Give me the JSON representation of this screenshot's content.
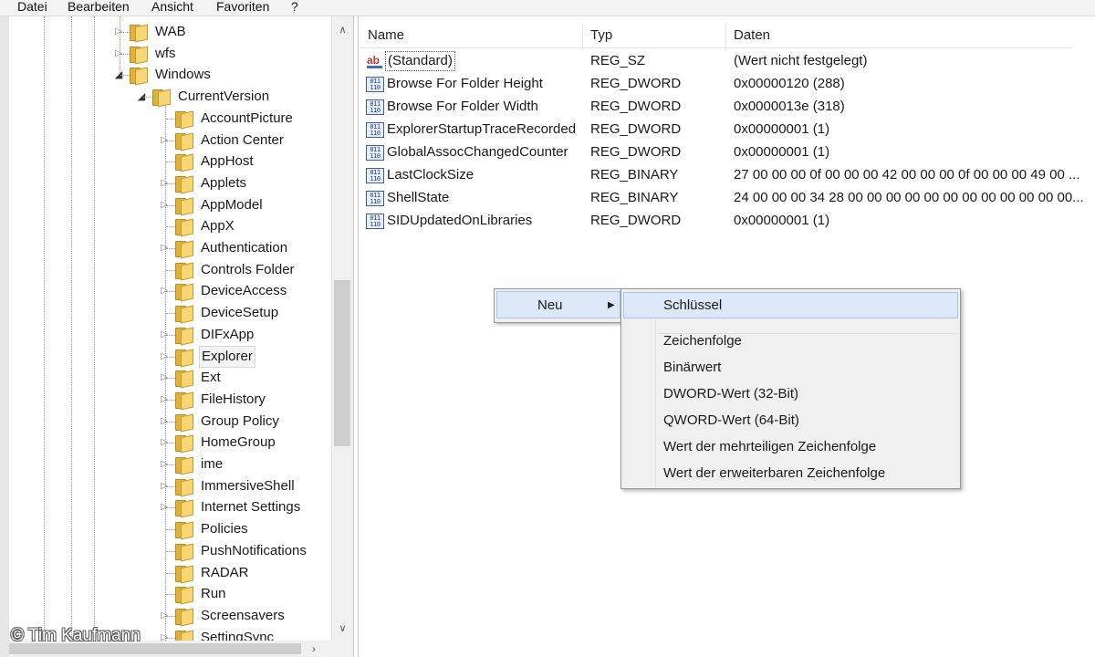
{
  "menubar": [
    "Datei",
    "Bearbeiten",
    "Ansicht",
    "Favoriten",
    "?"
  ],
  "tree": {
    "items": [
      {
        "label": "WAB",
        "expander": "collapsed",
        "level": 0
      },
      {
        "label": "wfs",
        "expander": "collapsed",
        "level": 0
      },
      {
        "label": "Windows",
        "expander": "expanded",
        "level": 0
      },
      {
        "label": "CurrentVersion",
        "expander": "expanded",
        "level": 1
      },
      {
        "label": "AccountPicture",
        "expander": "none",
        "level": 2
      },
      {
        "label": "Action Center",
        "expander": "collapsed",
        "level": 2
      },
      {
        "label": "AppHost",
        "expander": "none",
        "level": 2
      },
      {
        "label": "Applets",
        "expander": "collapsed",
        "level": 2
      },
      {
        "label": "AppModel",
        "expander": "collapsed",
        "level": 2
      },
      {
        "label": "AppX",
        "expander": "none",
        "level": 2
      },
      {
        "label": "Authentication",
        "expander": "collapsed",
        "level": 2
      },
      {
        "label": "Controls Folder",
        "expander": "none",
        "level": 2
      },
      {
        "label": "DeviceAccess",
        "expander": "collapsed",
        "level": 2
      },
      {
        "label": "DeviceSetup",
        "expander": "none",
        "level": 2
      },
      {
        "label": "DIFxApp",
        "expander": "collapsed",
        "level": 2
      },
      {
        "label": "Explorer",
        "expander": "collapsed",
        "level": 2,
        "selected": true
      },
      {
        "label": "Ext",
        "expander": "collapsed",
        "level": 2
      },
      {
        "label": "FileHistory",
        "expander": "collapsed",
        "level": 2
      },
      {
        "label": "Group Policy",
        "expander": "collapsed",
        "level": 2
      },
      {
        "label": "HomeGroup",
        "expander": "collapsed",
        "level": 2
      },
      {
        "label": "ime",
        "expander": "collapsed",
        "level": 2
      },
      {
        "label": "ImmersiveShell",
        "expander": "collapsed",
        "level": 2
      },
      {
        "label": "Internet Settings",
        "expander": "collapsed",
        "level": 2
      },
      {
        "label": "Policies",
        "expander": "none",
        "level": 2
      },
      {
        "label": "PushNotifications",
        "expander": "none",
        "level": 2
      },
      {
        "label": "RADAR",
        "expander": "none",
        "level": 2
      },
      {
        "label": "Run",
        "expander": "none",
        "level": 2
      },
      {
        "label": "Screensavers",
        "expander": "collapsed",
        "level": 2
      },
      {
        "label": "SettingSync",
        "expander": "collapsed",
        "level": 2
      }
    ],
    "scroll_up": "∧",
    "scroll_down": "∨",
    "scroll_right": "›"
  },
  "watermark": "© Tim Kaufmann",
  "list": {
    "columns": [
      "Name",
      "Typ",
      "Daten"
    ],
    "rows": [
      {
        "icon": "string-value-icon",
        "name": "(Standard)",
        "type": "REG_SZ",
        "data": "(Wert nicht festgelegt)"
      },
      {
        "icon": "binary-value-icon",
        "name": "Browse For Folder Height",
        "type": "REG_DWORD",
        "data": "0x00000120 (288)"
      },
      {
        "icon": "binary-value-icon",
        "name": "Browse For Folder Width",
        "type": "REG_DWORD",
        "data": "0x0000013e (318)"
      },
      {
        "icon": "binary-value-icon",
        "name": "ExplorerStartupTraceRecorded",
        "type": "REG_DWORD",
        "data": "0x00000001 (1)"
      },
      {
        "icon": "binary-value-icon",
        "name": "GlobalAssocChangedCounter",
        "type": "REG_DWORD",
        "data": "0x00000001 (1)"
      },
      {
        "icon": "binary-value-icon",
        "name": "LastClockSize",
        "type": "REG_BINARY",
        "data": "27 00 00 00 0f 00 00 00 42 00 00 00 0f 00 00 00 49 00 ..."
      },
      {
        "icon": "binary-value-icon",
        "name": "ShellState",
        "type": "REG_BINARY",
        "data": "24 00 00 00 34 28 00 00 00 00 00 00 00 00 00 00 00 00..."
      },
      {
        "icon": "binary-value-icon",
        "name": "SIDUpdatedOnLibraries",
        "type": "REG_DWORD",
        "data": "0x00000001 (1)"
      }
    ]
  },
  "context_menu": {
    "label": "Neu",
    "submenu_arrow": "▶"
  },
  "submenu": {
    "items": [
      "Schlüssel",
      "Zeichenfolge",
      "Binärwert",
      "DWORD-Wert (32-Bit)",
      "QWORD-Wert (64-Bit)",
      "Wert der mehrteiligen Zeichenfolge",
      "Wert der erweiterbaren Zeichenfolge"
    ],
    "highlighted_index": 0
  },
  "colors": {
    "highlight": "#dce8f8",
    "folder": "#f7d675",
    "menu_bg": "#f0f0f0"
  }
}
